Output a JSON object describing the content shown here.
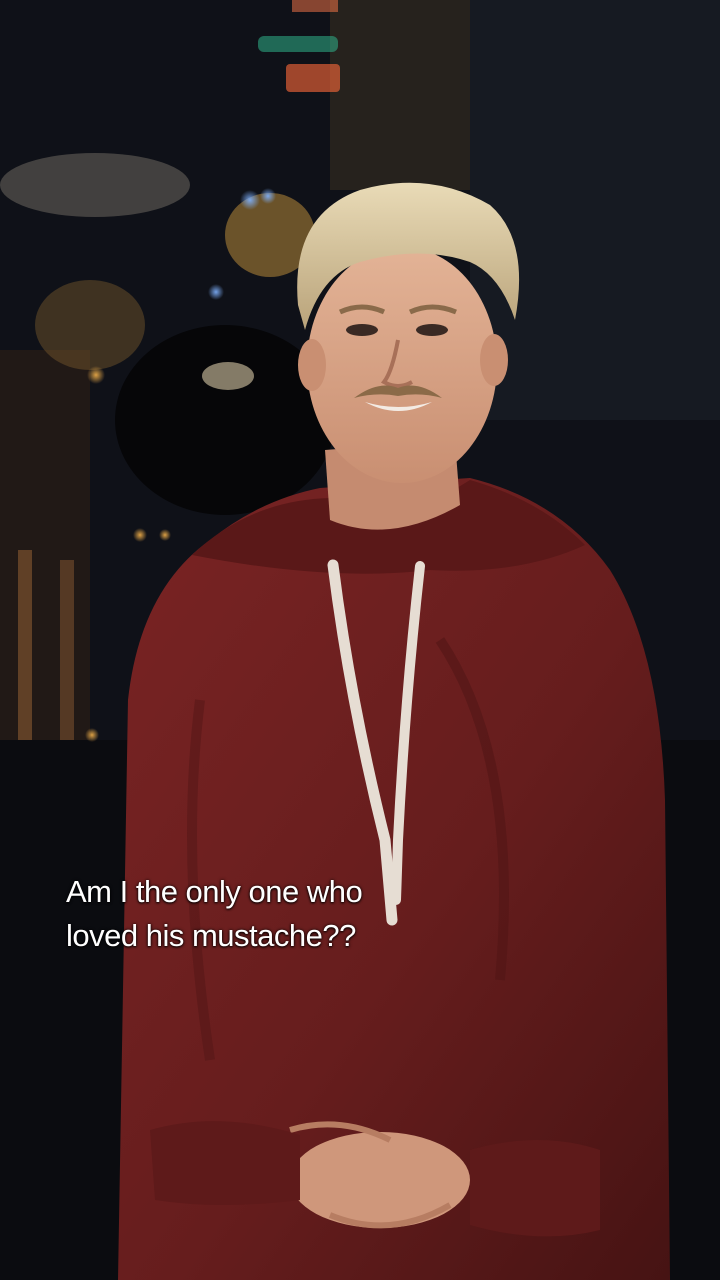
{
  "video": {
    "subject": "person-portrait",
    "caption_lines": [
      "Am I the only one who",
      "loved his mustache??"
    ]
  },
  "colors": {
    "hoodie": "#6e1f1f",
    "hoodie_shadow": "#4a1414",
    "drawstring": "#e6ddd3",
    "hair": "#d8c7a0",
    "skin": "#d6a488",
    "background": "#0e1016",
    "caption_text": "#ffffff"
  }
}
